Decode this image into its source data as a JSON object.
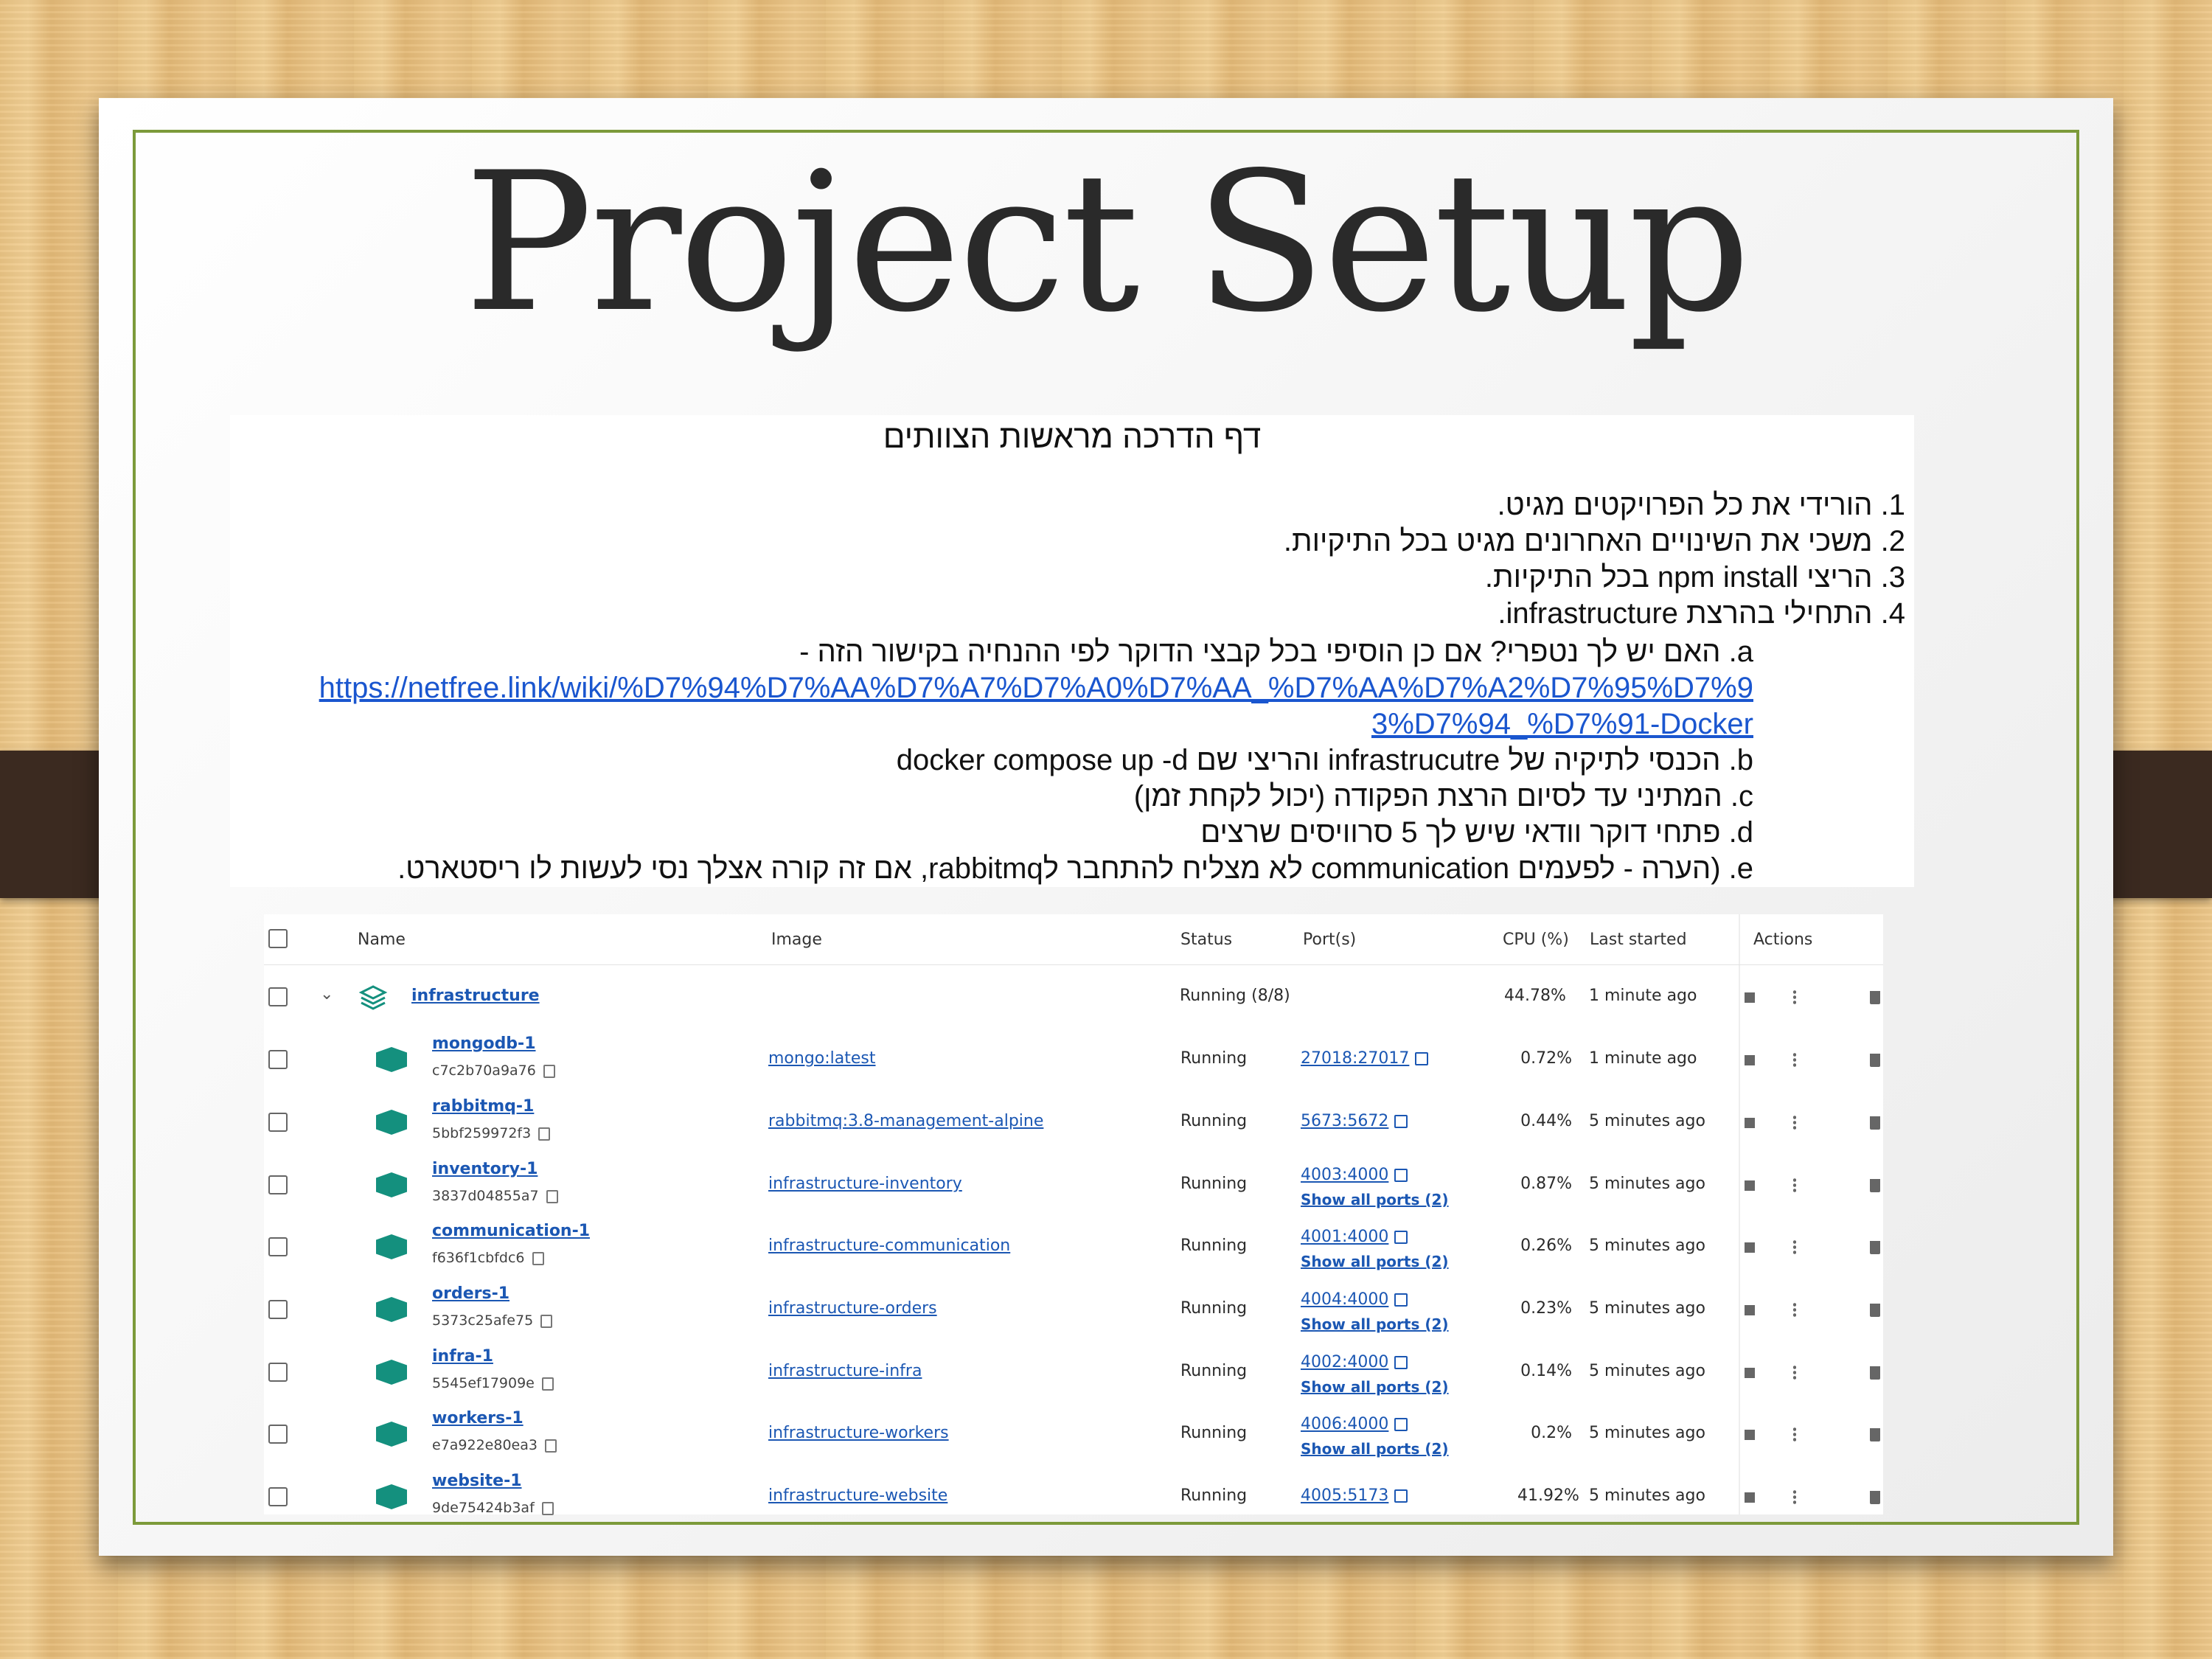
{
  "slide": {
    "title": "Project Setup"
  },
  "doc": {
    "heading": "דף הדרכה מראשות הצוותים",
    "steps": [
      "1. הורידי את כל הפרויקטים מגיט.",
      "2. משכי את השינויים האחרונים מגיט בכל התיקיות.",
      "3. הריצי npm install בכל התיקיות.",
      "4. התחילי בהרצת infrastructure."
    ],
    "substeps": {
      "a": "a. האם יש לך נטפרי? אם כן הוסיפי בכל קבצי הדוקר לפי ההנחיה בקישור הזה -",
      "link_line1": "https://netfree.link/wiki/%D7%94%D7%AA%D7%A7%D7%A0%D7%AA_%D7%AA%D7%A2%D7%95%D7%9",
      "link_line2": "3%D7%94_%D7%91-Docker",
      "b": "b. הכנסי לתיקיה של infrastrucutre והריצי שם docker compose up -d",
      "c": "c. המתיני עד לסיום הרצת הפקודה (יכול לקחת זמן)",
      "d": "d. פתחי דוקר וודאי שיש לך 5 סרוויסים שרצים",
      "e": "e. (הערה - לפעמים communication לא מצליח להתחבר לrabbitmq, אם זה קורה אצלך נסי לעשות לו ריסטארט."
    }
  },
  "docker": {
    "headers": {
      "name": "Name",
      "image": "Image",
      "status": "Status",
      "ports": "Port(s)",
      "cpu": "CPU (%)",
      "last_started": "Last started",
      "actions": "Actions"
    },
    "group": {
      "name": "infrastructure",
      "status": "Running (8/8)",
      "cpu": "44.78%",
      "last_started": "1 minute ago"
    },
    "containers": [
      {
        "name": "mongodb-1",
        "id": "c7c2b70a9a76",
        "image": "mongo:latest",
        "status": "Running",
        "port": "27018:27017",
        "show_all": "",
        "cpu": "0.72%",
        "last_started": "1 minute ago"
      },
      {
        "name": "rabbitmq-1",
        "id": "5bbf259972f3",
        "image": "rabbitmq:3.8-management-alpine",
        "status": "Running",
        "port": "5673:5672",
        "show_all": "",
        "cpu": "0.44%",
        "last_started": "5 minutes ago"
      },
      {
        "name": "inventory-1",
        "id": "3837d04855a7",
        "image": "infrastructure-inventory",
        "status": "Running",
        "port": "4003:4000",
        "show_all": "Show all ports (2)",
        "cpu": "0.87%",
        "last_started": "5 minutes ago"
      },
      {
        "name": "communication-1",
        "id": "f636f1cbfdc6",
        "image": "infrastructure-communication",
        "status": "Running",
        "port": "4001:4000",
        "show_all": "Show all ports (2)",
        "cpu": "0.26%",
        "last_started": "5 minutes ago"
      },
      {
        "name": "orders-1",
        "id": "5373c25afe75",
        "image": "infrastructure-orders",
        "status": "Running",
        "port": "4004:4000",
        "show_all": "Show all ports (2)",
        "cpu": "0.23%",
        "last_started": "5 minutes ago"
      },
      {
        "name": "infra-1",
        "id": "5545ef17909e",
        "image": "infrastructure-infra",
        "status": "Running",
        "port": "4002:4000",
        "show_all": "Show all ports (2)",
        "cpu": "0.14%",
        "last_started": "5 minutes ago"
      },
      {
        "name": "workers-1",
        "id": "e7a922e80ea3",
        "image": "infrastructure-workers",
        "status": "Running",
        "port": "4006:4000",
        "show_all": "Show all ports (2)",
        "cpu": "0.2%",
        "last_started": "5 minutes ago"
      },
      {
        "name": "website-1",
        "id": "9de75424b3af",
        "image": "infrastructure-website",
        "status": "Running",
        "port": "4005:5173",
        "show_all": "",
        "cpu": "41.92%",
        "last_started": "5 minutes ago"
      }
    ]
  }
}
